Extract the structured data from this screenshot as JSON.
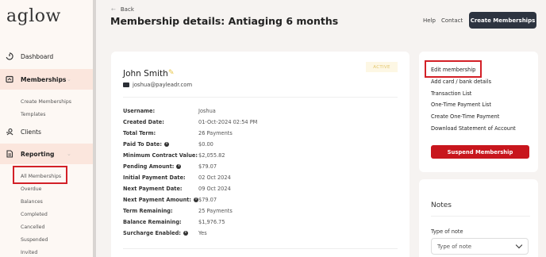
{
  "brand": {
    "logo": "aglow"
  },
  "sidebar": {
    "items": [
      {
        "label": "Dashboard"
      },
      {
        "label": "Memberships"
      },
      {
        "label": "Clients"
      },
      {
        "label": "Reporting"
      }
    ],
    "membership_sub": [
      "Create Memberships",
      "Templates"
    ],
    "reporting_sub": [
      "All Memberships",
      "Overdue",
      "Balances",
      "Completed",
      "Cancelled",
      "Suspended",
      "Invited"
    ]
  },
  "header": {
    "back": "Back",
    "title": "Membership details: Antiaging 6 months",
    "links": [
      "Help",
      "Contact"
    ],
    "create_button": "Create Memberships"
  },
  "member": {
    "name": "John Smith",
    "email": "joshua@payleadr.com",
    "status": "ACTIVE"
  },
  "details": [
    {
      "label": "Username:",
      "value": "Joshua"
    },
    {
      "label": "Created Date:",
      "value": "01-Oct-2024 02:54 PM"
    },
    {
      "label": "Total Term:",
      "value": "26 Payments"
    },
    {
      "label": "Paid To Date:",
      "value": "$0.00"
    },
    {
      "label": "Minimum Contract Value:",
      "value": "$2,055.82"
    },
    {
      "label": "Pending Amount:",
      "value": "$79.07"
    },
    {
      "label": "Initial Payment Date:",
      "value": "02 Oct 2024"
    },
    {
      "label": "Next Payment Date:",
      "value": "09 Oct 2024"
    },
    {
      "label": "Next Payment Amount:",
      "value": "$79.07"
    },
    {
      "label": "Term Remaining:",
      "value": "25 Payments"
    },
    {
      "label": "Balance Remaining:",
      "value": "$1,976.75"
    },
    {
      "label": "Surcharge Enabled:",
      "value": "Yes"
    }
  ],
  "actions": [
    "Edit membership",
    "Add card / bank details",
    "Transaction List",
    "One-Time Payment List",
    "Create One-Time Payment",
    "Download Statement of Account"
  ],
  "suspend_button": "Suspend Membership",
  "notes": {
    "title": "Notes",
    "type_label": "Type of note",
    "type_placeholder": "Type of note"
  }
}
